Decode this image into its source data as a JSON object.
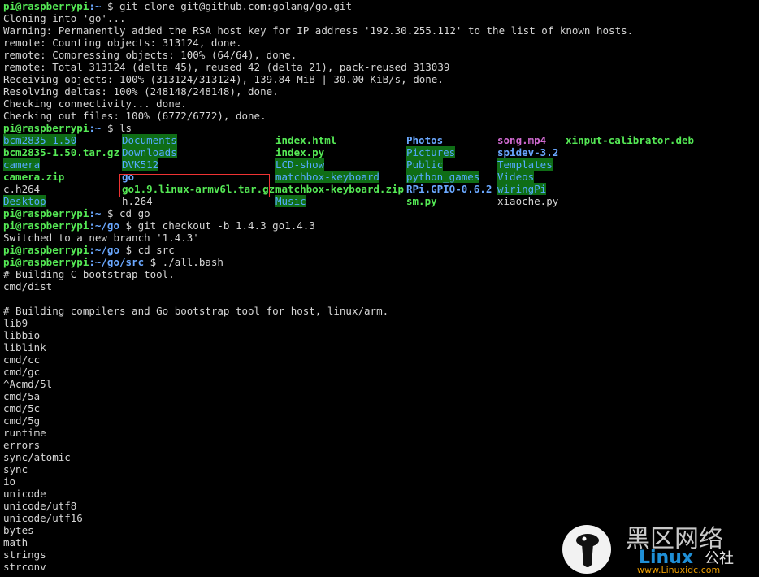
{
  "prompt_user": "pi@raspberrypi",
  "output": {
    "clone_1": "Cloning into 'go'...",
    "clone_2": "Warning: Permanently added the RSA host key for IP address '192.30.255.112' to the list of known hosts.",
    "clone_3": "remote: Counting objects: 313124, done.",
    "clone_4": "remote: Compressing objects: 100% (64/64), done.",
    "clone_5": "remote: Total 313124 (delta 45), reused 42 (delta 21), pack-reused 313039",
    "clone_6": "Receiving objects: 100% (313124/313124), 139.84 MiB | 30.00 KiB/s, done.",
    "clone_7": "Resolving deltas: 100% (248148/248148), done.",
    "clone_8": "Checking connectivity... done.",
    "clone_9": "Checking out files: 100% (6772/6772), done.",
    "checkout_1": "Switched to a new branch '1.4.3'",
    "build": [
      "# Building C bootstrap tool.",
      "cmd/dist",
      "",
      "# Building compilers and Go bootstrap tool for host, linux/arm.",
      "lib9",
      "libbio",
      "liblink",
      "cmd/cc",
      "cmd/gc",
      "^Acmd/5l",
      "cmd/5a",
      "cmd/5c",
      "cmd/5g",
      "runtime",
      "errors",
      "sync/atomic",
      "sync",
      "io",
      "unicode",
      "unicode/utf8",
      "unicode/utf16",
      "bytes",
      "math",
      "strings",
      "strconv"
    ]
  },
  "prompts": [
    {
      "path": ":~",
      "cmd": " $ git clone git@github.com:golang/go.git"
    },
    {
      "path": ":~",
      "cmd": " $ ls"
    },
    {
      "path": ":~",
      "cmd": " $ cd go"
    },
    {
      "path": ":~/go",
      "cmd": " $ git checkout -b 1.4.3 go1.4.3"
    },
    {
      "path": ":~/go",
      "cmd": " $ cd src"
    },
    {
      "path": ":~/go/src",
      "cmd": " $ ./all.bash"
    }
  ],
  "ls_rows": [
    [
      "bcm2835-1.50",
      "Documents",
      "index.html",
      "Photos",
      "song.mp4",
      "xinput-calibrator.deb"
    ],
    [
      "bcm2835-1.50.tar.gz",
      "Downloads",
      "index.py",
      "Pictures",
      "spidev-3.2",
      ""
    ],
    [
      "camera",
      "DVK512",
      "LCD-show",
      "Public",
      "Templates",
      ""
    ],
    [
      "camera.zip",
      "go",
      "matchbox-keyboard",
      "python_games",
      "Videos",
      ""
    ],
    [
      "c.h264",
      "go1.9.linux-armv6l.tar.gz",
      "matchbox-keyboard.zip",
      "RPi.GPIO-0.6.2",
      "wiringPi",
      ""
    ],
    [
      "Desktop",
      "h.264",
      "Music",
      "sm.py",
      "xiaoche.py",
      ""
    ]
  ],
  "ls_kinds": [
    [
      "dir-hl",
      "dir-hl",
      "archive",
      "dir",
      "media",
      "archive"
    ],
    [
      "archive",
      "dir-hl",
      "archive",
      "dir-hl",
      "dir",
      "plain"
    ],
    [
      "dir-hl",
      "dir-hl",
      "dir-hl",
      "dir-hl",
      "dir-hl",
      "plain"
    ],
    [
      "archive",
      "dir",
      "dir-hl",
      "dir-hl",
      "dir-hl",
      "plain"
    ],
    [
      "plain",
      "archive",
      "archive",
      "dir",
      "dir-hl",
      "plain"
    ],
    [
      "dir-hl",
      "plain",
      "dir-hl",
      "exec",
      "plain",
      "plain"
    ]
  ],
  "colors": {
    "user": "#55e955",
    "path": "#6aa8ff",
    "dir_bg": "#0f6d16",
    "highlight_box": "#ee3333"
  },
  "watermark": {
    "cn_text": "黑区网络",
    "brand": "Linux",
    "brand_suffix": "公社",
    "url": "www.Linuxidc.com",
    "icon": "tux-penguin-icon"
  }
}
